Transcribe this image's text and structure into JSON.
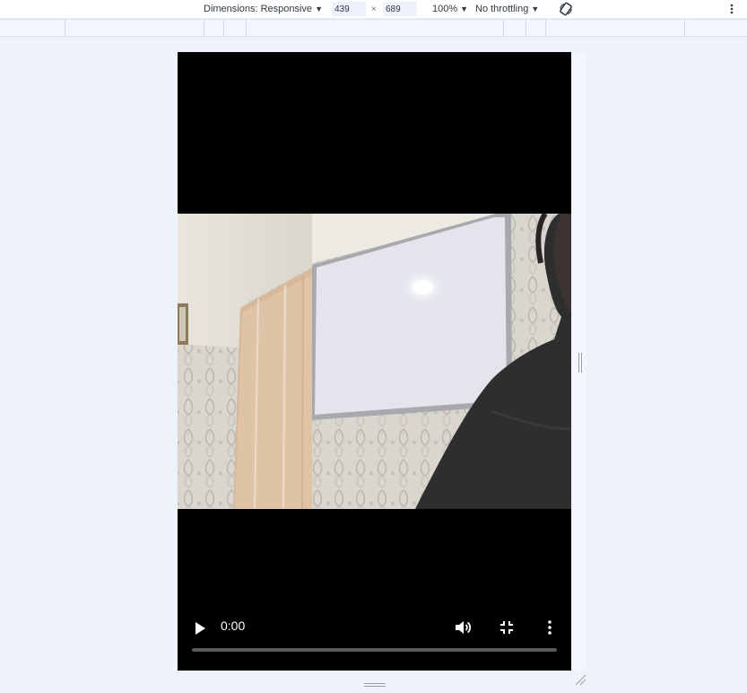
{
  "toolbar": {
    "dimensions_label": "Dimensions: Responsive",
    "width_value": "439",
    "times_symbol": "×",
    "height_value": "689",
    "zoom_label": "100%",
    "throttling_label": "No throttling",
    "rotate_icon": "rotate-icon",
    "more_icon": "more-vert-icon"
  },
  "video": {
    "time_display": "0:00",
    "progress_fraction": 0,
    "play_icon": "play-icon",
    "volume_icon": "volume-icon",
    "fullscreen_icon": "exit-fullscreen-icon",
    "menu_icon": "more-vert-icon"
  },
  "colors": {
    "page_background": "#eef2fa",
    "player_background": "#000000"
  }
}
